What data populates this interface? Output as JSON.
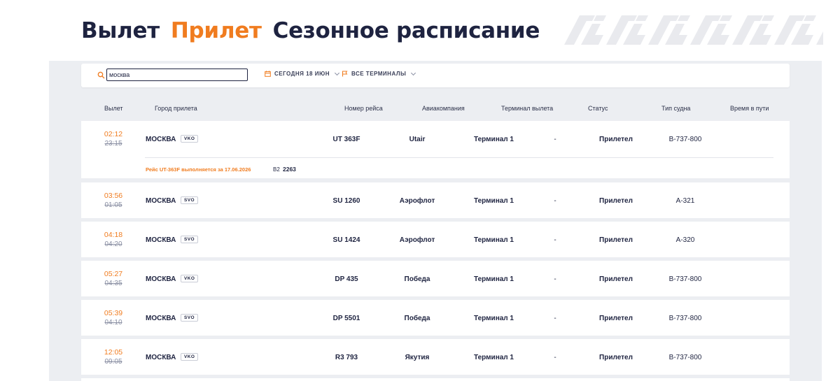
{
  "tabs": {
    "departure": "Вылет",
    "arrival": "Прилет",
    "seasonal": "Сезонное расписание"
  },
  "filters": {
    "search_value": "москва",
    "date_label": "СЕГОДНЯ 18 ИЮН",
    "terminal_label": "ВСЕ ТЕРМИНАЛЫ"
  },
  "columns": {
    "departure": "Вылет",
    "city": "Город прилета",
    "flight": "Номер рейса",
    "airline": "Авиакомпания",
    "terminal": "Терминал вылета",
    "status": "Статус",
    "aircraft": "Тип судна",
    "duration": "Время в пути"
  },
  "flights": [
    {
      "time_actual": "02:12",
      "time_planned": "23:15",
      "city": "МОСКВА",
      "airport": "VKO",
      "flight": "UT 363F",
      "airline": "Utair",
      "terminal": "Терминал 1",
      "gate": "-",
      "status": "Прилетел",
      "aircraft": "B-737-800",
      "note": "Рейс UT-363F выполняется за 17.06.2026",
      "note_code": "B2",
      "note_number": "2263"
    },
    {
      "time_actual": "03:56",
      "time_planned": "01:05",
      "city": "МОСКВА",
      "airport": "SVO",
      "flight": "SU 1260",
      "airline": "Аэрофлот",
      "terminal": "Терминал 1",
      "gate": "-",
      "status": "Прилетел",
      "aircraft": "A-321"
    },
    {
      "time_actual": "04:18",
      "time_planned": "04:20",
      "city": "МОСКВА",
      "airport": "SVO",
      "flight": "SU 1424",
      "airline": "Аэрофлот",
      "terminal": "Терминал 1",
      "gate": "-",
      "status": "Прилетел",
      "aircraft": "A-320"
    },
    {
      "time_actual": "05:27",
      "time_planned": "04:35",
      "city": "МОСКВА",
      "airport": "VKO",
      "flight": "DP 435",
      "airline": "Победа",
      "terminal": "Терминал 1",
      "gate": "-",
      "status": "Прилетел",
      "aircraft": "B-737-800"
    },
    {
      "time_actual": "05:39",
      "time_planned": "04:10",
      "city": "МОСКВА",
      "airport": "SVO",
      "flight": "DP 5501",
      "airline": "Победа",
      "terminal": "Терминал 1",
      "gate": "-",
      "status": "Прилетел",
      "aircraft": "B-737-800"
    },
    {
      "time_actual": "12:05",
      "time_planned": "09:05",
      "city": "МОСКВА",
      "airport": "VKO",
      "flight": "R3 793",
      "airline": "Якутия",
      "terminal": "Терминал 1",
      "gate": "-",
      "status": "Прилетел",
      "aircraft": "B-737-800"
    }
  ],
  "colors": {
    "accent": "#f07c1f",
    "text": "#1e2340",
    "panel": "#eceef2"
  },
  "icons": {
    "search": "search-icon",
    "calendar": "calendar-icon",
    "terminal": "flag-icon",
    "ornament": "ornament-pattern"
  }
}
